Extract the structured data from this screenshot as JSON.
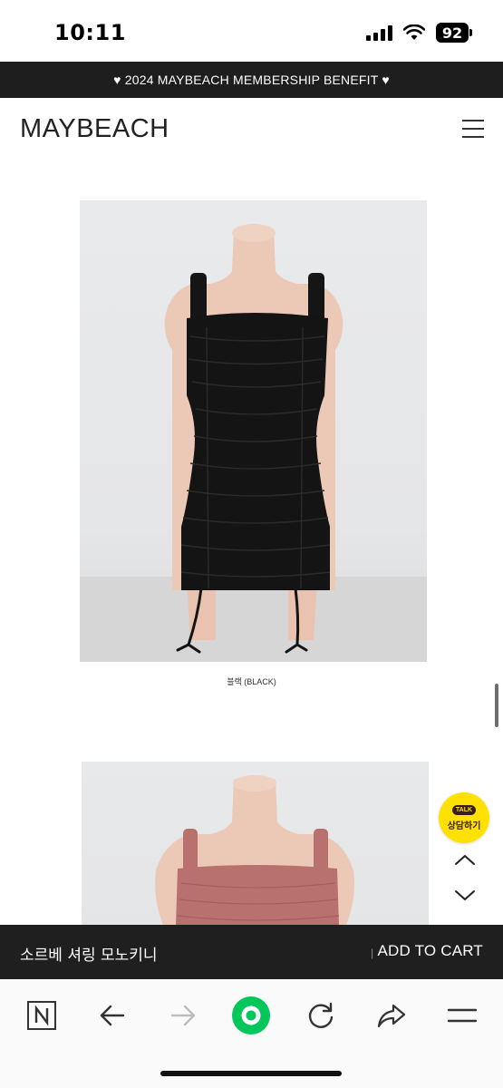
{
  "status_bar": {
    "time": "10:11",
    "battery": "92"
  },
  "promo": {
    "text": "♥ 2024 MAYBEACH MEMBERSHIP BENEFIT ♥"
  },
  "header": {
    "brand": "MAYBEACH",
    "menu_icon": "hamburger-menu-icon"
  },
  "product": {
    "images": [
      {
        "caption": "블랙 (BLACK)",
        "color": "#141414"
      },
      {
        "caption": "",
        "color": "#b9716f"
      }
    ]
  },
  "floating": {
    "talk_badge": "TALK",
    "talk_label": "상담하기",
    "talk_color": "#ffe100"
  },
  "cart_bar": {
    "product_name": "소르베 셔링 모노키니",
    "divider": "|",
    "add_label": "ADD TO CART"
  },
  "browser": {
    "icons": [
      "naver-n-icon",
      "back-arrow-icon",
      "forward-arrow-icon",
      "home-circle-icon",
      "reload-icon",
      "share-icon",
      "menu-icon"
    ],
    "accent": "#03c75a"
  }
}
